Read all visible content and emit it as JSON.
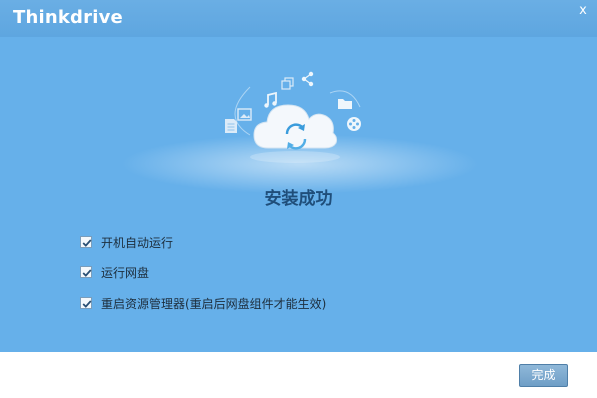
{
  "window": {
    "brand": "Thinkdrive",
    "close_glyph": "x"
  },
  "hero": {
    "icons": [
      "image-icon",
      "music-note-icon",
      "copy-icon",
      "share-icon",
      "folder-icon",
      "film-reel-icon",
      "document-icon",
      "cloud-sync-icon"
    ]
  },
  "main": {
    "title": "安装成功",
    "options": [
      {
        "label": "开机自动运行",
        "checked": true
      },
      {
        "label": "运行网盘",
        "checked": true
      },
      {
        "label": "重启资源管理器(重启后网盘组件才能生效)",
        "checked": true
      }
    ]
  },
  "footer": {
    "finish_label": "完成"
  },
  "colors": {
    "accent": "#66b0ea",
    "title": "#1f4e7a"
  }
}
